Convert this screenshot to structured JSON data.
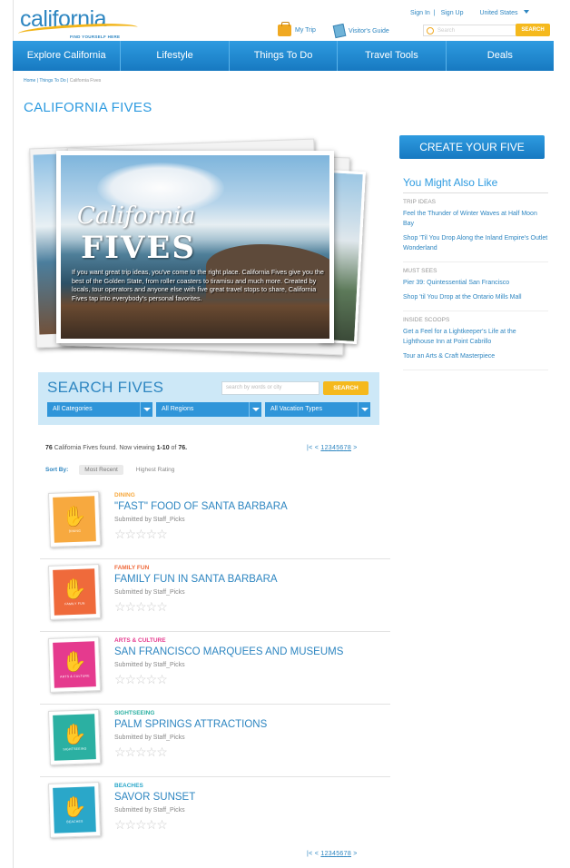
{
  "header": {
    "logo_text": "california",
    "logo_tagline": "FIND YOURSELF HERE",
    "sign_in": "Sign In",
    "sign_up": "Sign Up",
    "country": "United States",
    "my_trip": "My Trip",
    "visitors_guide": "Visitor's Guide",
    "search_placeholder": "Search",
    "search_button": "SEARCH"
  },
  "nav": [
    "Explore California",
    "Lifestyle",
    "Things To Do",
    "Travel Tools",
    "Deals"
  ],
  "breadcrumb": {
    "home": "Home",
    "things": "Things To Do",
    "current": "California Fives"
  },
  "page_title": "CALIFORNIA FIVES",
  "hero": {
    "script_title": "California",
    "big_title": "FIVES",
    "text": "If you want great trip ideas, you've come to the right place. California Fives give you the best of the Golden State, from roller coasters to tiramisu and much more. Created by locals, tour operators and anyone else with five great travel stops to share, California Fives tap into everybody's personal favorites."
  },
  "search_fives": {
    "title": "SEARCH FIVES",
    "placeholder": "search by words or city",
    "button": "SEARCH",
    "categories": "All Categories",
    "regions": "All Regions",
    "vacation_types": "All Vacation Types"
  },
  "results_meta": {
    "found_count": "76",
    "found_text": " California Fives found. Now viewing ",
    "range": "1-10",
    "of_text": " of ",
    "total": "76.",
    "pager_prefix": "|< < ",
    "pages": [
      "1",
      "2",
      "3",
      "4",
      "5",
      "6",
      "7",
      "8"
    ],
    "pager_suffix": " >"
  },
  "sort": {
    "label": "Sort By:",
    "options": [
      "Most Recent",
      "Highest Rating"
    ]
  },
  "results": [
    {
      "category": "DINING",
      "title": "\"FAST\" FOOD OF SANTA BARBARA",
      "submitted": "Submitted by Staff_Picks",
      "badge_label": "DINING",
      "color": "#f7a93f"
    },
    {
      "category": "FAMILY FUN",
      "title": "FAMILY FUN IN SANTA BARBARA",
      "submitted": "Submitted by Staff_Picks",
      "badge_label": "FAMILY FUN",
      "color": "#ef6a3b"
    },
    {
      "category": "ARTS & CULTURE",
      "title": "SAN FRANCISCO MARQUEES AND MUSEUMS",
      "submitted": "Submitted by Staff_Picks",
      "badge_label": "ARTS & CULTURE",
      "color": "#e53a8e"
    },
    {
      "category": "SIGHTSEEING",
      "title": "PALM SPRINGS ATTRACTIONS",
      "submitted": "Submitted by Staff_Picks",
      "badge_label": "SIGHTSEEING",
      "color": "#2bb0a2"
    },
    {
      "category": "BEACHES",
      "title": "SAVOR SUNSET",
      "submitted": "Submitted by Staff_Picks",
      "badge_label": "BEACHES",
      "color": "#2aa7c9"
    }
  ],
  "sidebar": {
    "create_button": "CREATE YOUR FIVE",
    "heading": "You Might Also Like",
    "sections": [
      {
        "head": "TRIP IDEAS",
        "links": [
          "Feel the Thunder of Winter Waves at Half Moon Bay",
          "Shop 'Til You Drop Along the Inland Empire's Outlet Wonderland"
        ]
      },
      {
        "head": "MUST SEES",
        "links": [
          "Pier 39: Quintessential San Francisco",
          "Shop 'til You Drop at the Ontario Mills Mall"
        ]
      },
      {
        "head": "INSIDE SCOOPS",
        "links": [
          "Get a Feel for a Lightkeeper's Life at the Lighthouse Inn at Point Cabrillo",
          "Tour an Arts & Craft Masterpiece"
        ]
      }
    ]
  },
  "icons": {
    "trip": "suitcase-icon",
    "guide": "book-icon",
    "search": "search-icon",
    "badge": "hand-five-icon",
    "rating": "star-outline-icon"
  }
}
